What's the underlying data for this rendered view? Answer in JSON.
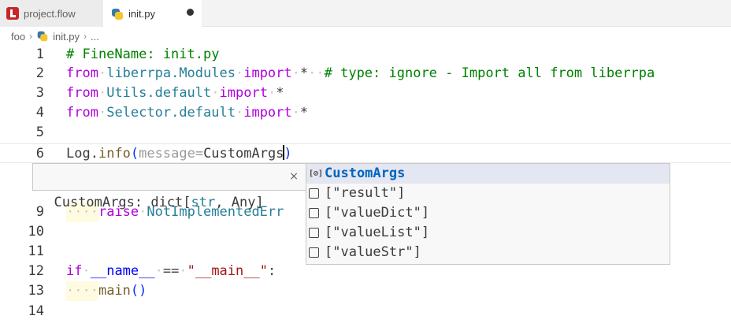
{
  "tabs": [
    {
      "label": "project.flow",
      "icon": "flow-file-icon",
      "active": false
    },
    {
      "label": "init.py",
      "icon": "python-file-icon",
      "active": true,
      "dirty": true
    }
  ],
  "breadcrumb": {
    "folder": "foo",
    "file": "init.py",
    "more": "..."
  },
  "editor": {
    "line_numbers": [
      "1",
      "2",
      "3",
      "4",
      "5",
      "6",
      "9",
      "10",
      "11",
      "12",
      "13",
      "14"
    ],
    "lines": {
      "l1": {
        "comment": "# FineName: init.py"
      },
      "l2": {
        "kw_from": "from",
        "module": "liberrpa.Modules",
        "kw_import": "import",
        "star": "*",
        "comment": "# type: ignore - Import all from liberrpa"
      },
      "l3": {
        "kw_from": "from",
        "module": "Utils.default",
        "kw_import": "import",
        "star": "*"
      },
      "l4": {
        "kw_from": "from",
        "module": "Selector.default",
        "kw_import": "import",
        "star": "*"
      },
      "l6": {
        "obj": "Log",
        "dot": ".",
        "method": "info",
        "open_paren": "(",
        "param": "message=",
        "arg": "CustomArgs",
        "close_paren": ")"
      },
      "l9": {
        "indent": "····",
        "kw_raise": "raise",
        "exc": "NotImplementedErr"
      },
      "l12": {
        "kw_if": "if",
        "name_var": "__name__",
        "eq": "==",
        "main_str": "\"__main__\"",
        "colon": ":"
      },
      "l13": {
        "indent": "····",
        "call": "main",
        "parens": "()"
      }
    }
  },
  "hover": {
    "name": "CustomArgs",
    "sep": ": ",
    "type_prefix": "dict[",
    "type_str": "str",
    "comma": ", ",
    "type_any": "Any",
    "type_suffix": "]",
    "close": "×"
  },
  "suggest": {
    "items": [
      {
        "label": "CustomArgs",
        "kind": "variable-icon",
        "icon_glyph": "[⊘]"
      },
      {
        "label": "[\"result\"]",
        "kind": "field-icon"
      },
      {
        "label": "[\"valueDict\"]",
        "kind": "field-icon"
      },
      {
        "label": "[\"valueList\"]",
        "kind": "field-icon"
      },
      {
        "label": "[\"valueStr\"]",
        "kind": "field-icon"
      }
    ]
  }
}
